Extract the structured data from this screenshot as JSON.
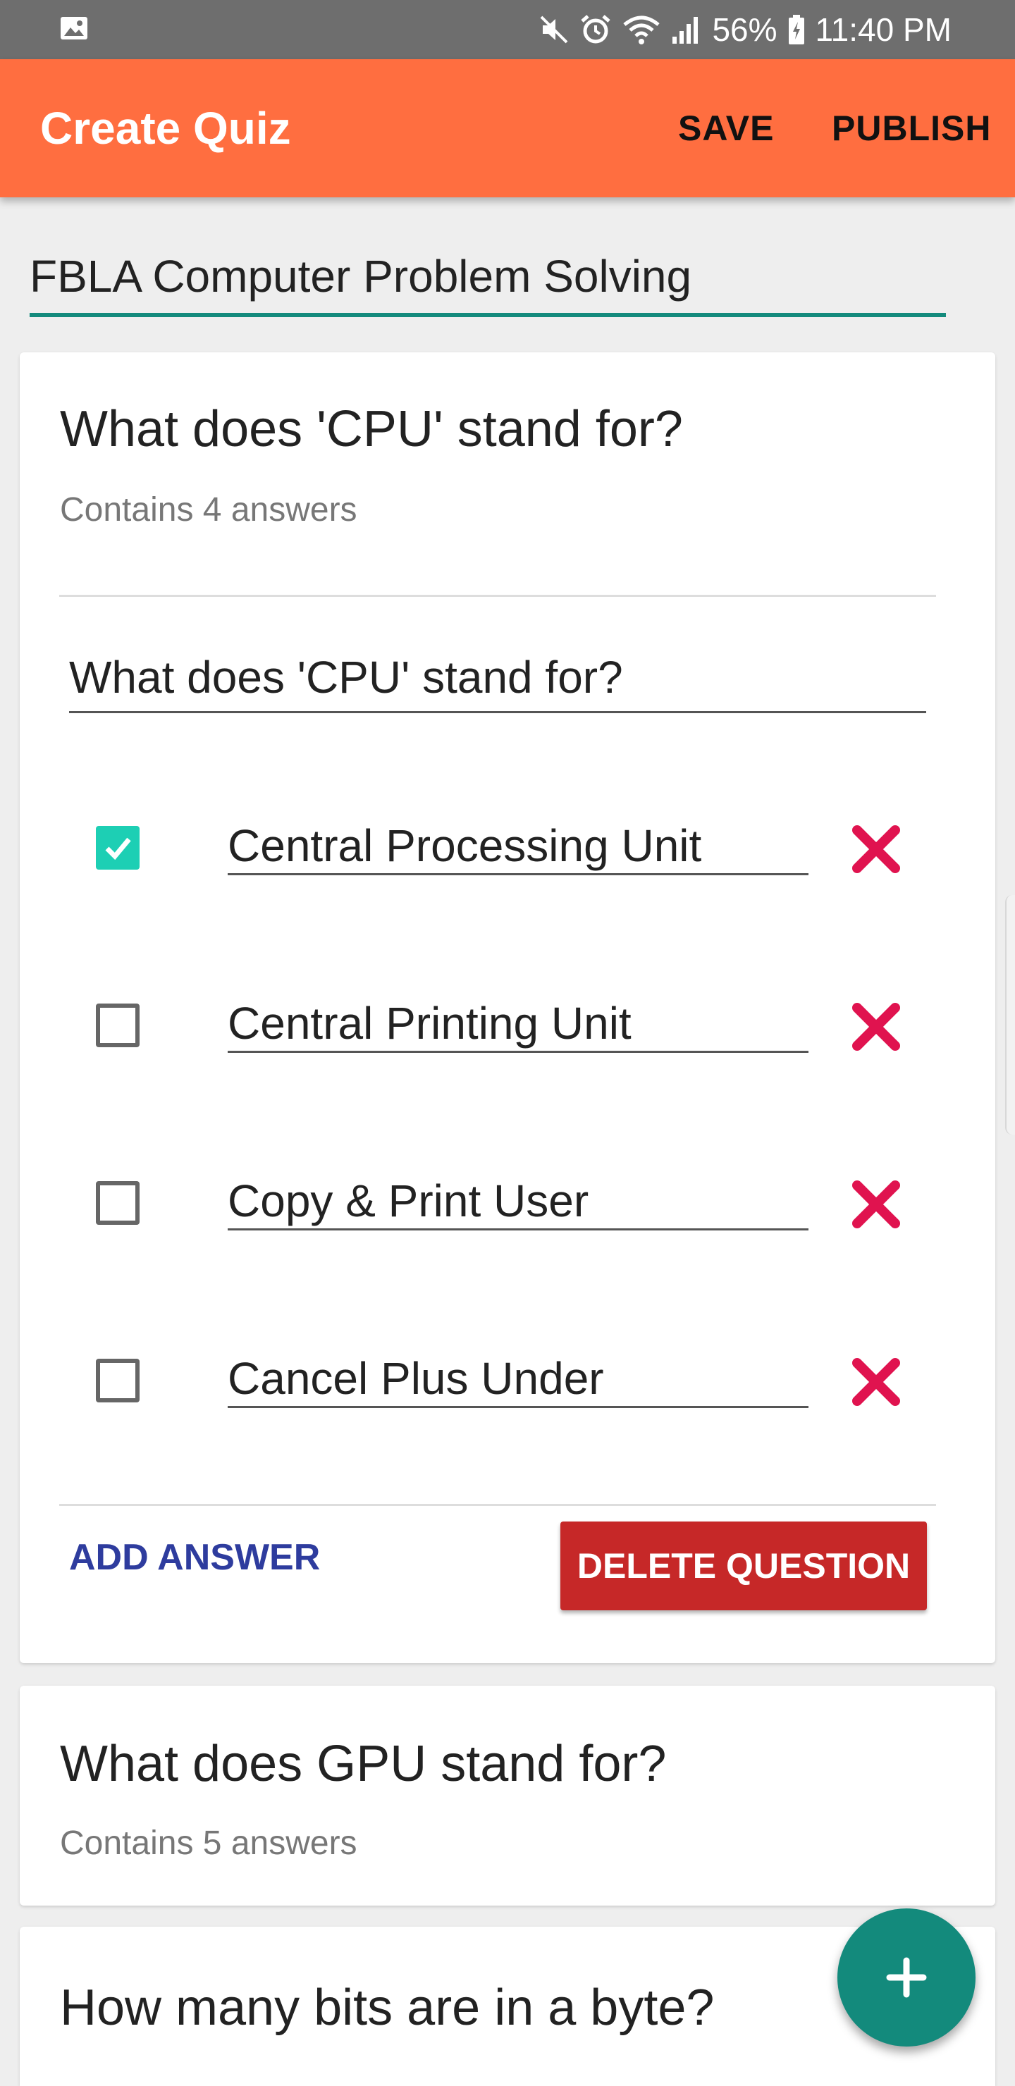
{
  "status_bar": {
    "battery": "56%",
    "time": "11:40 PM",
    "icons": [
      "gallery-icon",
      "mute-icon",
      "alarm-icon",
      "wifi-icon",
      "signal-icon",
      "battery-icon"
    ]
  },
  "app_bar": {
    "title": "Create Quiz",
    "save_label": "SAVE",
    "publish_label": "PUBLISH",
    "color": "#FF6E40"
  },
  "quiz": {
    "title": "FBLA Computer Problem Solving"
  },
  "questions": [
    {
      "title": "What does 'CPU' stand for?",
      "subtitle": "Contains 4 answers",
      "question_text": "What does 'CPU' stand for?",
      "answers": [
        {
          "text": "Central Processing Unit",
          "correct": true
        },
        {
          "text": "Central Printing Unit",
          "correct": false
        },
        {
          "text": "Copy & Print User",
          "correct": false
        },
        {
          "text": "Cancel Plus Under",
          "correct": false
        }
      ],
      "add_answer_label": "ADD ANSWER",
      "delete_question_label": "DELETE QUESTION"
    },
    {
      "title": "What does GPU stand for?",
      "subtitle": "Contains 5 answers"
    },
    {
      "title": "How many bits are in a byte?"
    }
  ],
  "fab": {
    "icon": "plus-icon",
    "color": "#138A7C"
  },
  "colors": {
    "checkbox_checked": "#1DCFB4",
    "delete_x": "#E0134F",
    "delete_button": "#C62828",
    "add_answer_text": "#2E3C9E"
  }
}
